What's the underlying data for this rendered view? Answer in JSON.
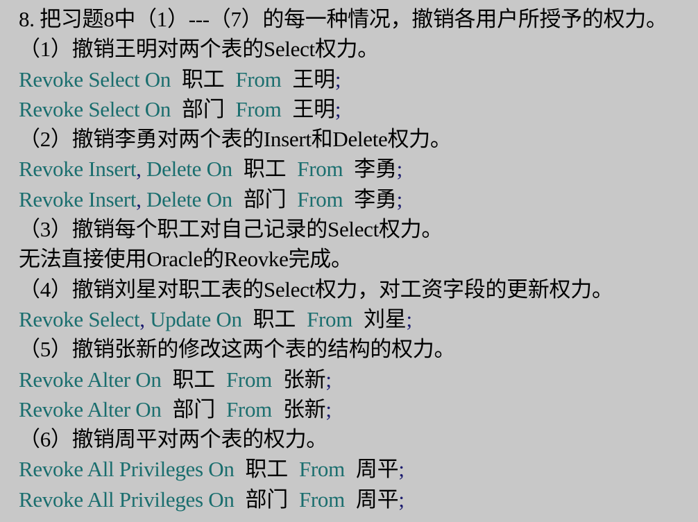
{
  "title": "8. 把习题8中（1）---（7）的每一种情况，撤销各用户所授予的权力。",
  "lines": [
    {
      "type": "text",
      "text": "（1）撤销王明对两个表的Select权力。"
    },
    {
      "type": "code",
      "stmt": "Revoke Select On",
      "table": "职工",
      "from": "From",
      "user": "王明",
      "end": ";"
    },
    {
      "type": "code",
      "stmt": "Revoke Select On",
      "table": "部门",
      "from": "From",
      "user": "王明",
      "end": ";"
    },
    {
      "type": "text",
      "text": "（2）撤销李勇对两个表的Insert和Delete权力。"
    },
    {
      "type": "code",
      "stmt": "Revoke Insert, Delete On",
      "table": "职工",
      "from": "From",
      "user": "李勇",
      "end": ";"
    },
    {
      "type": "code",
      "stmt": "Revoke Insert, Delete On",
      "table": "部门",
      "from": "From",
      "user": "李勇",
      "end": ";"
    },
    {
      "type": "text",
      "text": "（3）撤销每个职工对自己记录的Select权力。"
    },
    {
      "type": "text",
      "text": "无法直接使用Oracle的Reovke完成。"
    },
    {
      "type": "text",
      "text": "（4）撤销刘星对职工表的Select权力，对工资字段的更新权力。"
    },
    {
      "type": "code",
      "stmt": "Revoke Select, Update On",
      "table": "职工",
      "from": "From",
      "user": "刘星",
      "end": ";"
    },
    {
      "type": "text",
      "text": "（5）撤销张新的修改这两个表的结构的权力。"
    },
    {
      "type": "code",
      "stmt": "Revoke Alter On",
      "table": "职工",
      "from": "From",
      "user": "张新",
      "end": ";"
    },
    {
      "type": "code",
      "stmt": "Revoke Alter On",
      "table": "部门",
      "from": "From",
      "user": "张新",
      "end": ";"
    },
    {
      "type": "text",
      "text": "（6）撤销周平对两个表的权力。"
    },
    {
      "type": "code",
      "stmt": "Revoke All Privileges On",
      "table": "职工",
      "from": "From",
      "user": "周平",
      "end": ";"
    },
    {
      "type": "code",
      "stmt": "Revoke All Privileges On",
      "table": "部门",
      "from": "From",
      "user": "周平",
      "end": ";"
    }
  ],
  "colors": {
    "background": "#c8c8c8",
    "keyword": "#1a6e6e",
    "punctuation": "#1a1a6e",
    "text": "#000000"
  }
}
